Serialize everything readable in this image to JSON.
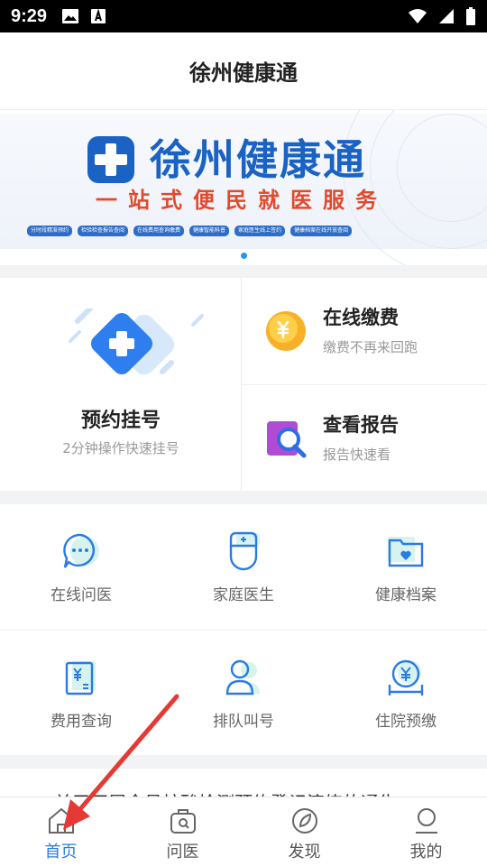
{
  "status_bar": {
    "time": "9:29",
    "left_icons": [
      "image-icon",
      "text-icon"
    ],
    "right_icons": [
      "wifi-icon",
      "signal-icon",
      "battery-icon"
    ]
  },
  "header": {
    "title": "徐州健康通"
  },
  "banner": {
    "title": "徐州健康通",
    "slogan": "一站式便民就医服务",
    "tags": [
      "分时段精准预约",
      "检验检查报告查阅",
      "在线费用查询缴费",
      "健康智能科普",
      "家庭医生线上签约",
      "健康档案在线开放查阅"
    ],
    "brand_color": "#1b62c5",
    "slogan_color": "#e2492a",
    "active_dot_color": "#2196f3"
  },
  "feature": {
    "main": {
      "title": "预约挂号",
      "subtitle": "2分钟操作快速挂号",
      "icon": "plus-diamond-icon"
    },
    "side": [
      {
        "title": "在线缴费",
        "subtitle": "缴费不再来回跑",
        "icon": "yuan-coin-icon"
      },
      {
        "title": "查看报告",
        "subtitle": "报告快速看",
        "icon": "report-search-icon"
      }
    ]
  },
  "services": [
    [
      {
        "label": "在线问医",
        "icon": "chat-bubble-icon"
      },
      {
        "label": "家庭医生",
        "icon": "doctor-icon"
      },
      {
        "label": "健康档案",
        "icon": "folder-heart-icon"
      }
    ],
    [
      {
        "label": "费用查询",
        "icon": "bill-icon"
      },
      {
        "label": "排队叫号",
        "icon": "queue-people-icon"
      },
      {
        "label": "住院预缴",
        "icon": "hospital-payment-icon"
      }
    ]
  ],
  "notice": {
    "text": "关于开展全员核酸检测预约登记演练的通告"
  },
  "bottom_nav": {
    "active_color": "#2a7be4",
    "items": [
      {
        "label": "首页",
        "icon": "home-icon",
        "active": true
      },
      {
        "label": "问医",
        "icon": "consult-bag-icon",
        "active": false
      },
      {
        "label": "发现",
        "icon": "compass-icon",
        "active": false
      },
      {
        "label": "我的",
        "icon": "profile-icon",
        "active": false
      }
    ]
  },
  "annotation": {
    "arrow_color": "#e53935"
  }
}
